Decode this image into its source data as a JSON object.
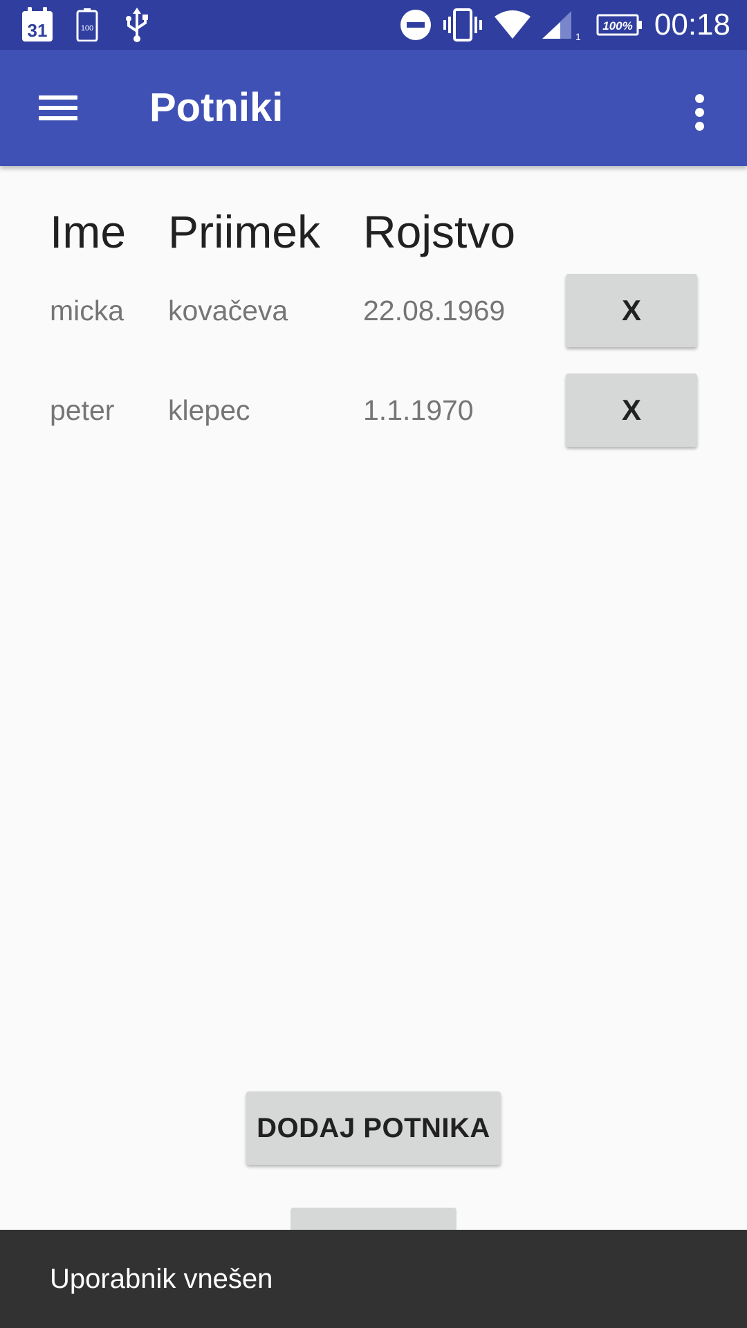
{
  "status_bar": {
    "calendar_day": "31",
    "battery_small": "100",
    "battery_percent": "100%",
    "signal_sub": "1",
    "time": "00:18"
  },
  "app_bar": {
    "title": "Potniki"
  },
  "table": {
    "headers": [
      "Ime",
      "Priimek",
      "Rojstvo"
    ],
    "rows": [
      {
        "ime": "micka",
        "priimek": "kovačeva",
        "rojstvo": "22.08.1969",
        "delete_label": "X"
      },
      {
        "ime": "peter",
        "priimek": "klepec",
        "rojstvo": "1.1.1970",
        "delete_label": "X"
      }
    ]
  },
  "actions": {
    "add_label": "DODAJ POTNIKA"
  },
  "snackbar": {
    "message": "Uporabnik vnešen"
  },
  "colors": {
    "status_bar": "#303f9f",
    "app_bar": "#3f51b5",
    "background": "#fafafa",
    "button": "#d6d7d7",
    "snackbar": "#323232"
  }
}
